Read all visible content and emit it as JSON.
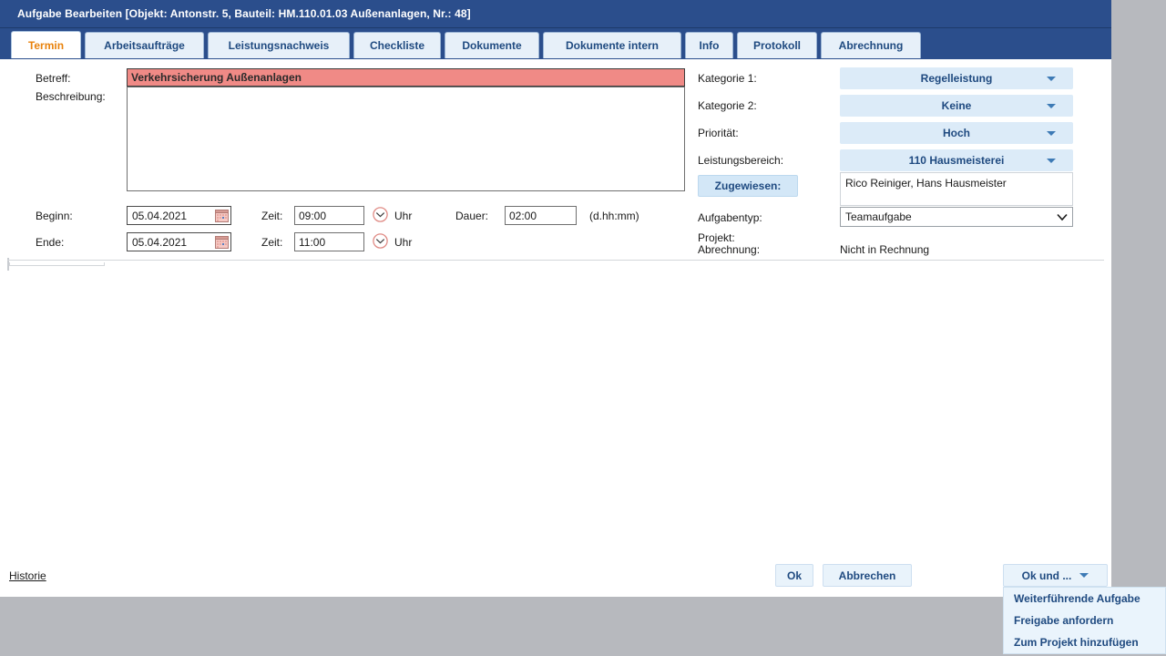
{
  "window": {
    "title": "Aufgabe Bearbeiten [Objekt: Antonstr. 5, Bauteil: HM.110.01.03 Außenanlagen, Nr.: 48]"
  },
  "tabs": [
    {
      "label": "Termin",
      "active": true
    },
    {
      "label": "Arbeitsaufträge",
      "active": false
    },
    {
      "label": "Leistungsnachweis",
      "active": false
    },
    {
      "label": "Checkliste",
      "active": false
    },
    {
      "label": "Dokumente",
      "active": false
    },
    {
      "label": "Dokumente intern",
      "active": false
    },
    {
      "label": "Info",
      "active": false
    },
    {
      "label": "Protokoll",
      "active": false
    },
    {
      "label": "Abrechnung",
      "active": false
    }
  ],
  "form": {
    "betreff": {
      "label": "Betreff:",
      "value": "Verkehrsicherung Außenanlagen",
      "placeholder": ""
    },
    "beschreibung": {
      "label": "Beschreibung:",
      "value": "",
      "placeholder": ""
    },
    "beginn": {
      "label": "Beginn:",
      "date": "05.04.2021",
      "zeit_label": "Zeit:",
      "zeit": "09:00",
      "uhr_label": "Uhr"
    },
    "ende": {
      "label": "Ende:",
      "date": "05.04.2021",
      "zeit_label": "Zeit:",
      "zeit": "11:00",
      "uhr_label": "Uhr"
    },
    "dauer": {
      "label": "Dauer:",
      "value": "02:00",
      "hint": "(d.hh:mm)"
    },
    "kategorie1": {
      "label": "Kategorie 1:",
      "value": "Regelleistung"
    },
    "kategorie2": {
      "label": "Kategorie 2:",
      "value": "Keine"
    },
    "prioritaet": {
      "label": "Priorität:",
      "value": "Hoch"
    },
    "leistungsbereich": {
      "label": "Leistungsbereich:",
      "value": "110 Hausmeisterei"
    },
    "zugewiesen": {
      "label": "Zugewiesen:",
      "value": "Rico Reiniger, Hans Hausmeister"
    },
    "aufgabentyp": {
      "label": "Aufgabentyp:",
      "value": "Teamaufgabe",
      "options": [
        "Teamaufgabe"
      ]
    },
    "projekt": {
      "label": "Projekt:",
      "value": ""
    },
    "abrechnung": {
      "label": "Abrechnung:",
      "value": "Nicht in Rechnung"
    }
  },
  "footer": {
    "historie_link": "Historie",
    "ok_label": "Ok",
    "abbrechen_label": "Abbrechen",
    "ok_und_label": "Ok und ...",
    "menu_items": [
      "Weiterführende Aufgabe",
      "Freigabe anfordern",
      "Zum Projekt hinzufügen"
    ]
  },
  "colors": {
    "title_bar": "#2b4e8c",
    "tab_active_text": "#e8820c",
    "accent_blue": "#1f4a80",
    "alert_field": "#f08a86",
    "combo_bg": "#dcebf8",
    "page_bg": "#b7b9be"
  }
}
